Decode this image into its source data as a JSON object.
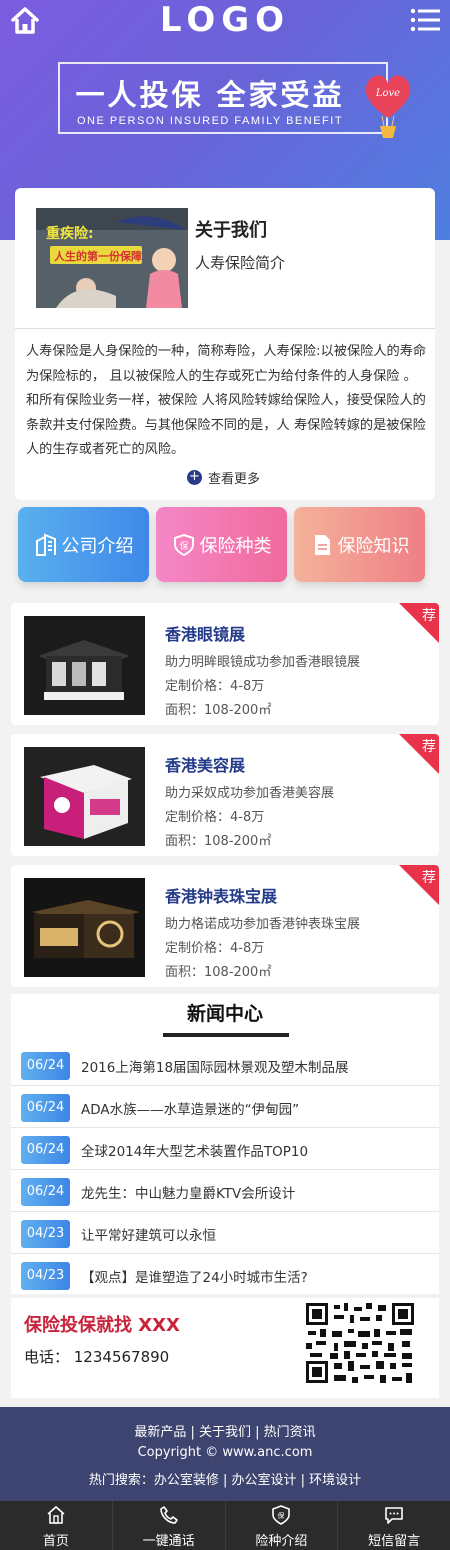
{
  "header": {
    "logo": "LOGO",
    "slogan_cn": "一人投保 全家受益",
    "slogan_en": "ONE PERSON INSURED FAMILY BENEFIT",
    "balloon_text": "Love"
  },
  "about": {
    "image_title": "重疾险:",
    "image_subtitle": "人生的第一份保障",
    "title": "关于我们",
    "subtitle": "人寿保险简介",
    "body": "人寿保险是人身保险的一种，简称寿险，人寿保险:以被保险人的寿命为保险标的， 且以被保险人的生存或死亡为给付条件的人身保险 。和所有保险业务一样，被保险 人将风险转嫁给保险人，接受保险人的条款并支付保险费。与其他保险不同的是，人 寿保险转嫁的是被保险人的生存或者死亡的风险。",
    "more": "查看更多"
  },
  "categories": [
    {
      "label": "公司介绍",
      "icon": "building-icon"
    },
    {
      "label": "保险种类",
      "icon": "shield-badge-icon"
    },
    {
      "label": "保险知识",
      "icon": "document-icon"
    }
  ],
  "products": [
    {
      "title": "香港眼镜展",
      "desc": "助力明眸眼镜成功参加香港眼镜展",
      "price": "定制价格：4-8万",
      "area": "面积：108-200㎡",
      "tag": "荐"
    },
    {
      "title": "香港美容展",
      "desc": "助力采奴成功参加香港美容展",
      "price": "定制价格：4-8万",
      "area": "面积：108-200㎡",
      "tag": "荐"
    },
    {
      "title": "香港钟表珠宝展",
      "desc": "助力格诺成功参加香港钟表珠宝展",
      "price": "定制价格：4-8万",
      "area": "面积：108-200㎡",
      "tag": "荐"
    }
  ],
  "news": {
    "title": "新闻中心",
    "items": [
      {
        "date": "06/24",
        "text": "2016上海第18届国际园林景观及塑木制品展"
      },
      {
        "date": "06/24",
        "text": "ADA水族——水草造景迷的“伊甸园”"
      },
      {
        "date": "06/24",
        "text": "全球2014年大型艺术装置作品TOP10"
      },
      {
        "date": "06/24",
        "text": "龙先生：中山魅力皇爵KTV会所设计"
      },
      {
        "date": "04/23",
        "text": "让平常好建筑可以永恒"
      },
      {
        "date": "04/23",
        "text": "【观点】是谁塑造了24小时城市生活?"
      }
    ]
  },
  "contact": {
    "title": "保险投保就找 XXX",
    "phone": "电话：  1234567890"
  },
  "footer": {
    "links_line": "最新产品 | 关于我们 | 热门资讯",
    "copyright": "Copyright ©  www.anc.com",
    "hot_search": "热门搜索：办公室装修  |  办公室设计  |  环境设计"
  },
  "bottom_nav": [
    {
      "label": "首页",
      "icon": "home-icon"
    },
    {
      "label": "一键通话",
      "icon": "phone-icon"
    },
    {
      "label": "险种介绍",
      "icon": "shield-icon"
    },
    {
      "label": "短信留言",
      "icon": "message-icon"
    }
  ],
  "colors": {
    "hero_start": "#7b5ce0",
    "hero_end": "#4f7fe0",
    "accent_red": "#e8334a",
    "title_blue": "#243b8a",
    "footer_bg": "#3e4470",
    "nav_bg": "#2b2b2b"
  }
}
